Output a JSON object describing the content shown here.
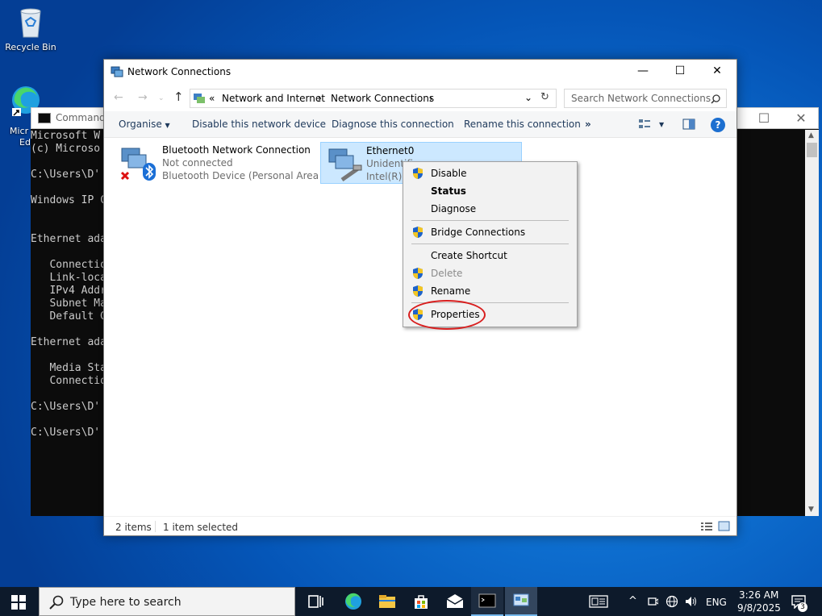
{
  "desktop": {
    "recycle_bin": "Recycle Bin",
    "edge_partial": "Micr",
    "edge_partial2": "Ed"
  },
  "cmd": {
    "title": "Command",
    "lines": [
      "Microsoft W",
      "(c) Microso",
      "",
      "C:\\Users\\D'",
      "",
      "Windows IP C",
      "",
      "",
      "Ethernet ada",
      "",
      "   Connectio",
      "   Link-loca",
      "   IPv4 Addr",
      "   Subnet Ma",
      "   Default G",
      "",
      "Ethernet ada",
      "",
      "   Media Sta",
      "   Connectio",
      "",
      "C:\\Users\\D'",
      "",
      "C:\\Users\\D'"
    ]
  },
  "explorer": {
    "title": "Network Connections",
    "breadcrumb": {
      "prefix": "«",
      "path1": "Network and Internet",
      "sep": "›",
      "path2": "Network Connections"
    },
    "search_placeholder": "Search Network Connections",
    "toolbar": {
      "organise": "Organise",
      "disable": "Disable this network device",
      "diagnose": "Diagnose this connection",
      "rename": "Rename this connection",
      "more": "»",
      "help": "?"
    },
    "items": [
      {
        "name": "Bluetooth Network Connection",
        "status": "Not connected",
        "device": "Bluetooth Device (Personal Area ..."
      },
      {
        "name": "Ethernet0",
        "status": "Unidentifi",
        "device": "Intel(R) 8"
      }
    ],
    "statusbar": {
      "count": "2 items",
      "selected": "1 item selected"
    }
  },
  "context_menu": {
    "items": [
      {
        "label": "Disable",
        "shield": true
      },
      {
        "label": "Status",
        "bold": true
      },
      {
        "label": "Diagnose"
      },
      {
        "label": "Bridge Connections",
        "shield": true
      },
      {
        "label": "Create Shortcut"
      },
      {
        "label": "Delete",
        "shield": true,
        "disabled": true
      },
      {
        "label": "Rename",
        "shield": true
      },
      {
        "label": "Properties",
        "shield": true
      }
    ]
  },
  "taskbar": {
    "search_placeholder": "Type here to search",
    "time": "3:26 AM",
    "date": "9/8/2025",
    "lang": "ENG",
    "notif_count": "3"
  },
  "colors": {
    "selection": "#cce8ff",
    "highlight_ring": "#d81e1e",
    "taskbar": "#0d1a2b"
  }
}
